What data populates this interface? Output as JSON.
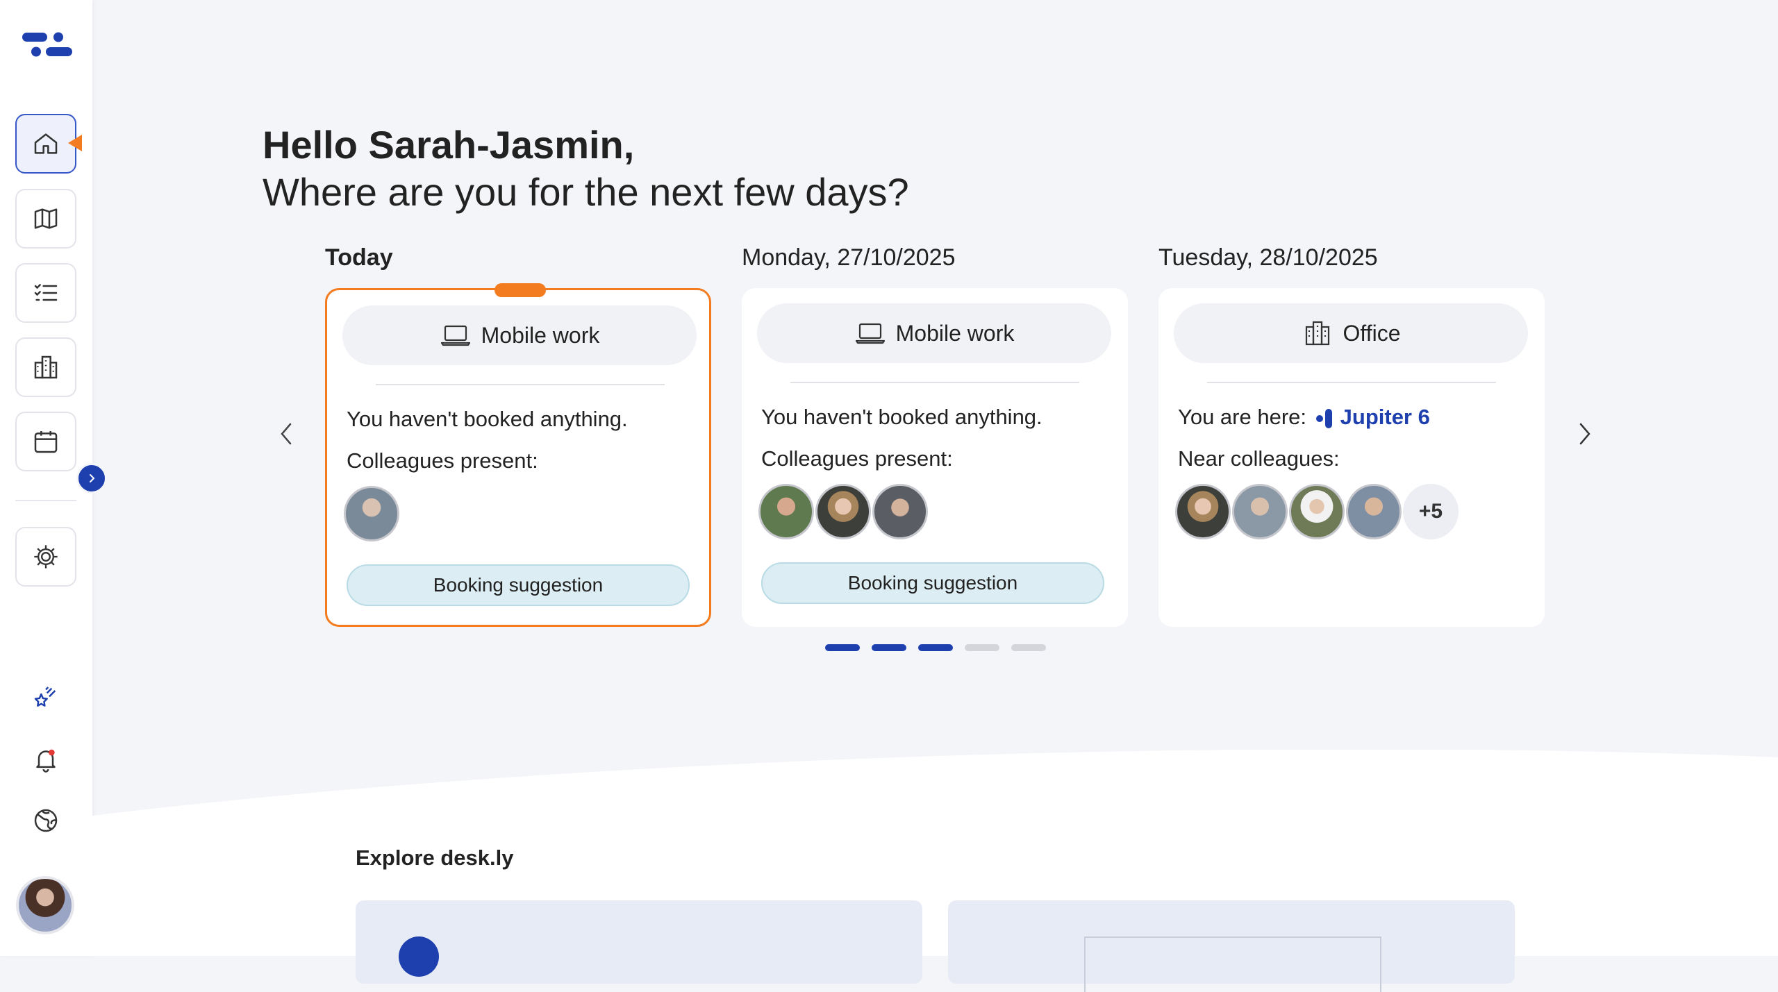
{
  "greeting": {
    "title": "Hello Sarah-Jasmin,",
    "subtitle": "Where are you for the next few days?"
  },
  "sidebar": {
    "nav_items": [
      {
        "icon": "home-icon",
        "active": true
      },
      {
        "icon": "map-icon",
        "active": false
      },
      {
        "icon": "checklist-icon",
        "active": false
      },
      {
        "icon": "buildings-icon",
        "active": false
      },
      {
        "icon": "calendar-icon",
        "active": false
      },
      {
        "icon": "settings-icon",
        "active": false
      }
    ],
    "bottom_icons": [
      "whats-new-icon",
      "notifications-icon",
      "language-icon"
    ],
    "accent": "#1e40af",
    "active_marker": "#f47c20",
    "notification_dot": "#e53935"
  },
  "days": [
    {
      "label": "Today",
      "mode": "Mobile work",
      "mode_icon": "laptop-icon",
      "line1": "You haven't booked anything.",
      "line2": "Colleagues present:",
      "more": "",
      "button": "Booking suggestion"
    },
    {
      "label": "Monday, 27/10/2025",
      "mode": "Mobile work",
      "mode_icon": "laptop-icon",
      "line1": "You haven't booked anything.",
      "line2": "Colleagues present:",
      "more": "",
      "button": "Booking suggestion"
    },
    {
      "label": "Tuesday, 28/10/2025",
      "mode": "Office",
      "mode_icon": "building-icon",
      "line1_prefix": "You are here:",
      "location": "Jupiter 6",
      "line2": "Near colleagues:",
      "more": "+5"
    }
  ],
  "pager": {
    "total": 5,
    "active": 3
  },
  "explore": {
    "title": "Explore desk.ly"
  },
  "colors": {
    "brand": "#1e40af",
    "today_border": "#f47c20",
    "suggestion_bg": "#dcedf3",
    "background": "#f4f5f9"
  }
}
